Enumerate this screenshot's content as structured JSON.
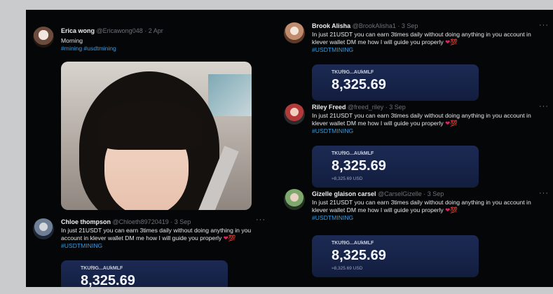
{
  "tweets": {
    "erica": {
      "name": "Erica wong",
      "handle": "@Ericawong048 · 2 Apr",
      "text": "Morning",
      "hashtags": "#mining #usdtmining"
    },
    "chloe": {
      "name": "Chloe thompson",
      "handle": "@Chloeth89720419 · 3 Sep",
      "text": "In just 21USDT you can earn 3times daily without doing anything in you account in klever wallet DM me how I will guide you properly",
      "hashtag": "#USDTMINING",
      "wallet": {
        "address": "TKUf9G...AUkMLF",
        "amount": "8,325.69"
      }
    },
    "brook": {
      "name": "Brook Alisha",
      "handle": "@BrookAlisha1 · 3 Sep",
      "text": "In just 21USDT you can earn 3times daily without doing anything in you account in klever wallet DM me how I will guide you properly",
      "hashtag": "#USDTMINING",
      "wallet": {
        "address": "TKUf9G...AUkMLF",
        "amount": "8,325.69"
      }
    },
    "riley": {
      "name": "Riley Freed",
      "handle": "@freed_riley · 3 Sep",
      "text": "In just 21USDT you can earn 3times daily without doing anything in you account in klever wallet DM me how I will guide you properly",
      "hashtag": "#USDTMINING",
      "wallet": {
        "address": "TKUf9G...AUkMLF",
        "amount": "8,325.69",
        "usd": "≈8,325.69 USD"
      }
    },
    "gizelle": {
      "name": "Gizelle glaison carsel",
      "handle": "@CarselGizelle · 3 Sep",
      "text": "In just 21USDT you can earn 3times daily without doing anything in you account in klever wallet DM me how I will guide you properly",
      "hashtag": "#USDTMINING",
      "wallet": {
        "address": "TKUf9G...AUkMLF",
        "amount": "8,325.69",
        "usd": "≈8,325.69 USD"
      }
    }
  },
  "ui": {
    "more": "···",
    "heart": "❤",
    "emoji": "💯"
  }
}
